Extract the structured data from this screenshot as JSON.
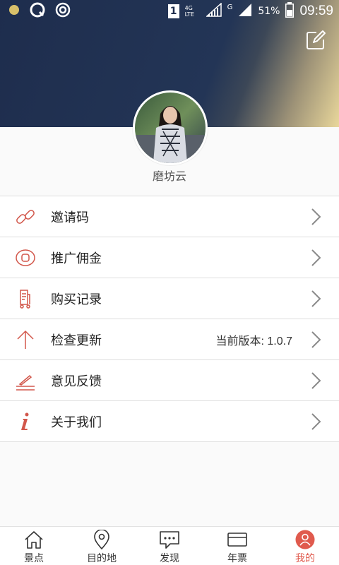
{
  "status_bar": {
    "sim_label": "1",
    "network_label": "4G LTE",
    "signal_label": "G",
    "battery": "51%",
    "time": "09:59"
  },
  "header": {
    "edit_icon": "edit-icon"
  },
  "profile": {
    "name": "磨坊云"
  },
  "menu": {
    "items": [
      {
        "label": "邀请码",
        "icon": "link-icon"
      },
      {
        "label": "推广佣金",
        "icon": "coin-icon"
      },
      {
        "label": "购买记录",
        "icon": "cart-icon"
      },
      {
        "label": "检查更新",
        "icon": "arrow-up-icon",
        "value": "当前版本: 1.0.7"
      },
      {
        "label": "意见反馈",
        "icon": "feedback-icon"
      },
      {
        "label": "关于我们",
        "icon": "info-icon"
      }
    ]
  },
  "bottom_nav": {
    "active_color": "#e05a4d",
    "items": [
      {
        "label": "景点",
        "icon": "home-icon"
      },
      {
        "label": "目的地",
        "icon": "location-icon"
      },
      {
        "label": "发现",
        "icon": "chat-icon"
      },
      {
        "label": "年票",
        "icon": "card-icon"
      },
      {
        "label": "我的",
        "icon": "user-icon",
        "active": true
      }
    ]
  },
  "colors": {
    "header_dark": "#1e2d4d",
    "header_gold": "#e9d79b",
    "icon_red": "#d2574b"
  }
}
